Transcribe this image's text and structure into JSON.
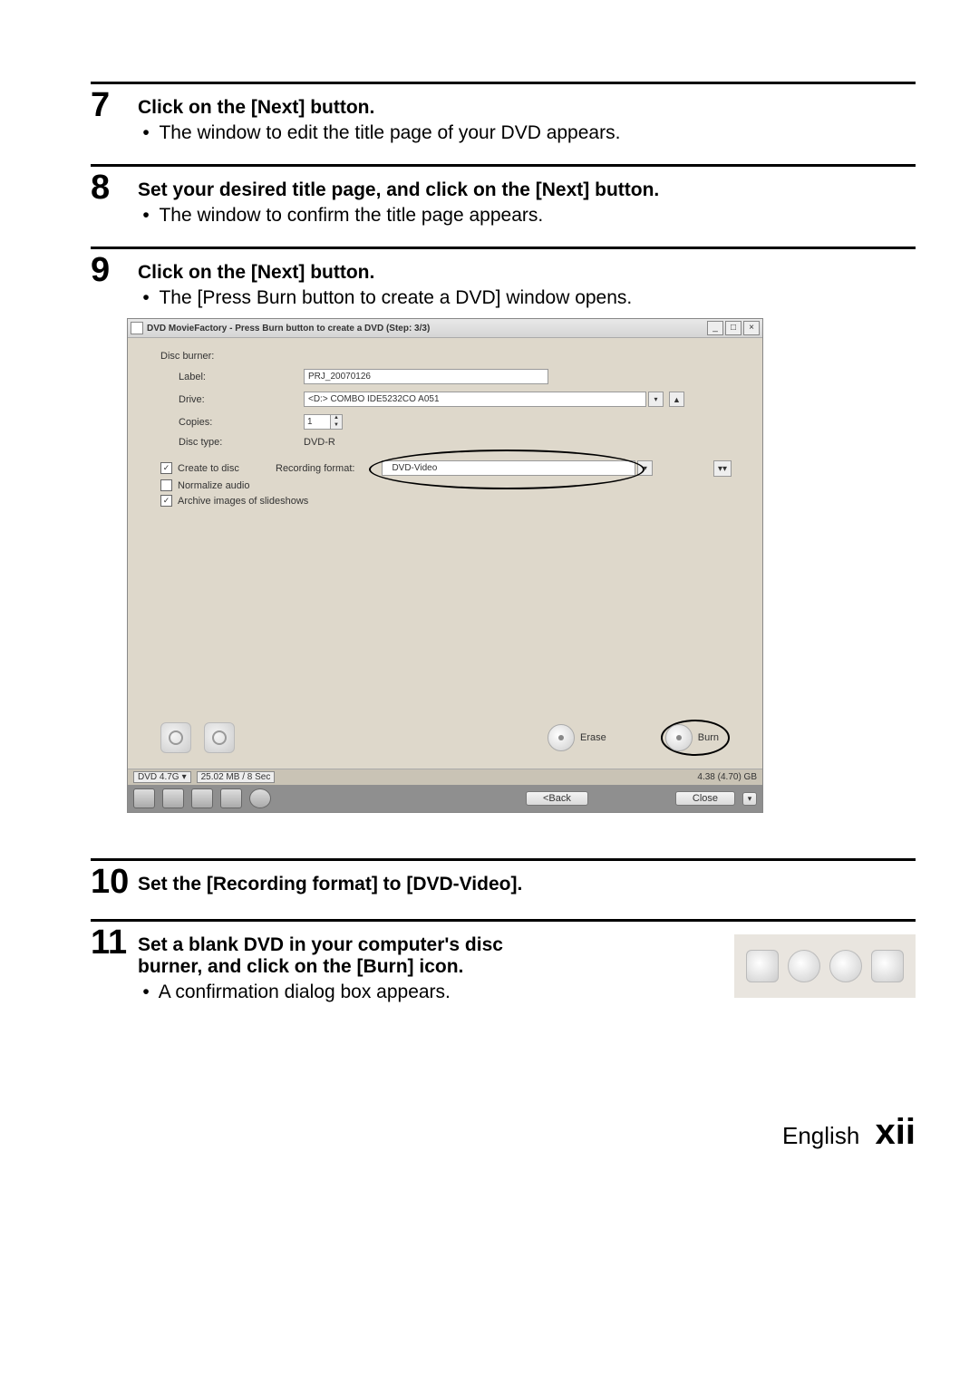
{
  "steps": {
    "s7": {
      "num": "7",
      "title": "Click on the [Next] button.",
      "sub": "The window to edit the title page of your DVD appears."
    },
    "s8": {
      "num": "8",
      "title": "Set your desired title page, and click on the [Next] button.",
      "sub": "The window to confirm the title page appears."
    },
    "s9": {
      "num": "9",
      "title": "Click on the [Next] button.",
      "sub": "The [Press Burn button to create a DVD] window opens."
    },
    "s10": {
      "num": "10",
      "title": "Set the [Recording format] to [DVD-Video]."
    },
    "s11": {
      "num": "11",
      "title": "Set a blank DVD in your computer's disc burner, and click on the [Burn] icon.",
      "sub": "A confirmation dialog box appears."
    }
  },
  "window": {
    "title": "DVD MovieFactory - Press Burn button to create a DVD (Step: 3/3)",
    "sectionLabel": "Disc burner:",
    "labelLabel": "Label:",
    "labelValue": "PRJ_20070126",
    "driveLabel": "Drive:",
    "driveValue": "<D:>  COMBO IDE5232CO  A051",
    "copiesLabel": "Copies:",
    "copiesValue": "1",
    "discTypeLabel": "Disc type:",
    "discTypeValue": "DVD-R",
    "chkCreate": "Create to disc",
    "chkNormalize": "Normalize audio",
    "chkArchive": "Archive images of slideshows",
    "recFormatLabel": "Recording format:",
    "recFormatValue": "DVD-Video",
    "eraseLabel": "Erase",
    "burnLabel": "Burn",
    "statusDisc": "DVD 4.7G",
    "statusSize": "25.02 MB / 8 Sec",
    "statusCap": "4.38 (4.70) GB",
    "backBtn": "<Back",
    "closeBtn": "Close"
  },
  "footer": {
    "lang": "English",
    "page": "xii"
  }
}
